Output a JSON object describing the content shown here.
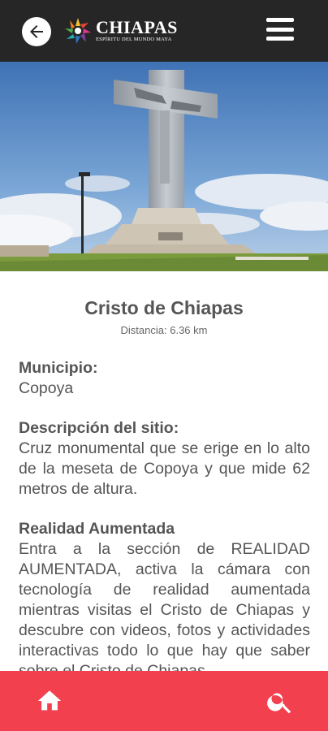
{
  "header": {
    "back_icon": "back-arrow-icon",
    "logo_title": "CHIAPAS",
    "logo_subtitle": "ESPÍRITU DEL MUNDO MAYA",
    "menu_icon": "hamburger-menu-icon"
  },
  "site": {
    "name": "Cristo de Chiapas",
    "distance": "Distancia: 6.36 km",
    "municipio_label": "Municipio:",
    "municipio_value": "Copoya",
    "descripcion_label": "Descripción del sitio:",
    "descripcion_value": "Cruz monumental que se erige en lo alto de la meseta de Copoya y que mide 62 metros de altura.",
    "ra_label": "Realidad Aumentada",
    "ra_value": "Entra a la sección de REALIDAD AUMENTADA, activa la cámara con tecnología de realidad aumentada mientras visitas el Cristo de Chiapas y descubre con videos, fotos y actividades interactivas todo lo que hay que saber sobre el Cristo de Chiapas."
  },
  "bottom_nav": {
    "home_icon": "home-icon",
    "search_icon": "search-icon"
  },
  "colors": {
    "topbar": "#262626",
    "bottombar": "#f2404f",
    "text": "#555555"
  }
}
